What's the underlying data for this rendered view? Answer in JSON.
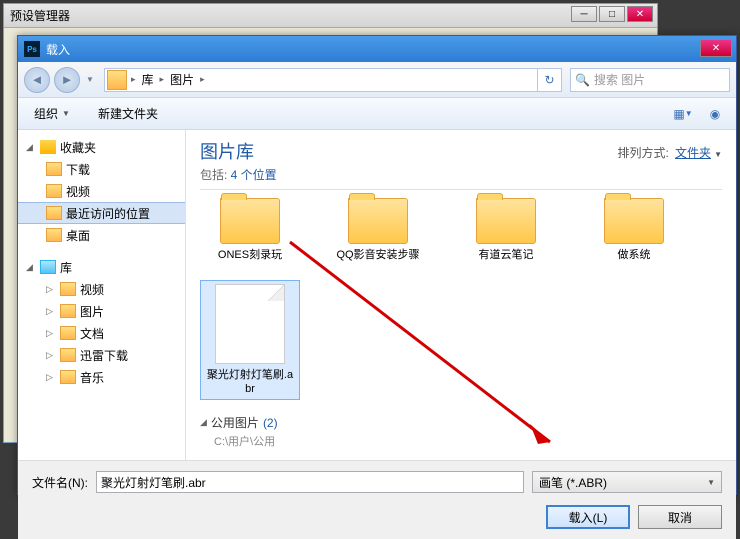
{
  "parent": {
    "title": "预设管理器"
  },
  "dialog": {
    "title": "载入",
    "breadcrumb": {
      "root": "库",
      "folder": "图片"
    },
    "search_placeholder": "搜索 图片",
    "toolbar": {
      "organize": "组织",
      "new_folder": "新建文件夹"
    },
    "sidebar": {
      "favorites": {
        "label": "收藏夹",
        "items": [
          "下载",
          "视频",
          "最近访问的位置",
          "桌面"
        ]
      },
      "libraries": {
        "label": "库",
        "items": [
          "视频",
          "图片",
          "文档",
          "迅雷下载",
          "音乐"
        ]
      }
    },
    "content": {
      "lib_title": "图片库",
      "lib_sub_prefix": "包括: ",
      "lib_sub_link": "4 个位置",
      "sort_label": "排列方式:",
      "sort_value": "文件夹",
      "folders": [
        "ONES刻录玩",
        "QQ影音安装步骤",
        "有道云笔记",
        "做系统"
      ],
      "file": "聚光灯射灯笔刷.abr",
      "section2": {
        "name": "公用图片",
        "count": "(2)",
        "path": "C:\\用户\\公用"
      }
    },
    "footer": {
      "filename_label": "文件名(N):",
      "filename_value": "聚光灯射灯笔刷.abr",
      "filter": "画笔 (*.ABR)",
      "open": "载入(L)",
      "cancel": "取消"
    }
  }
}
